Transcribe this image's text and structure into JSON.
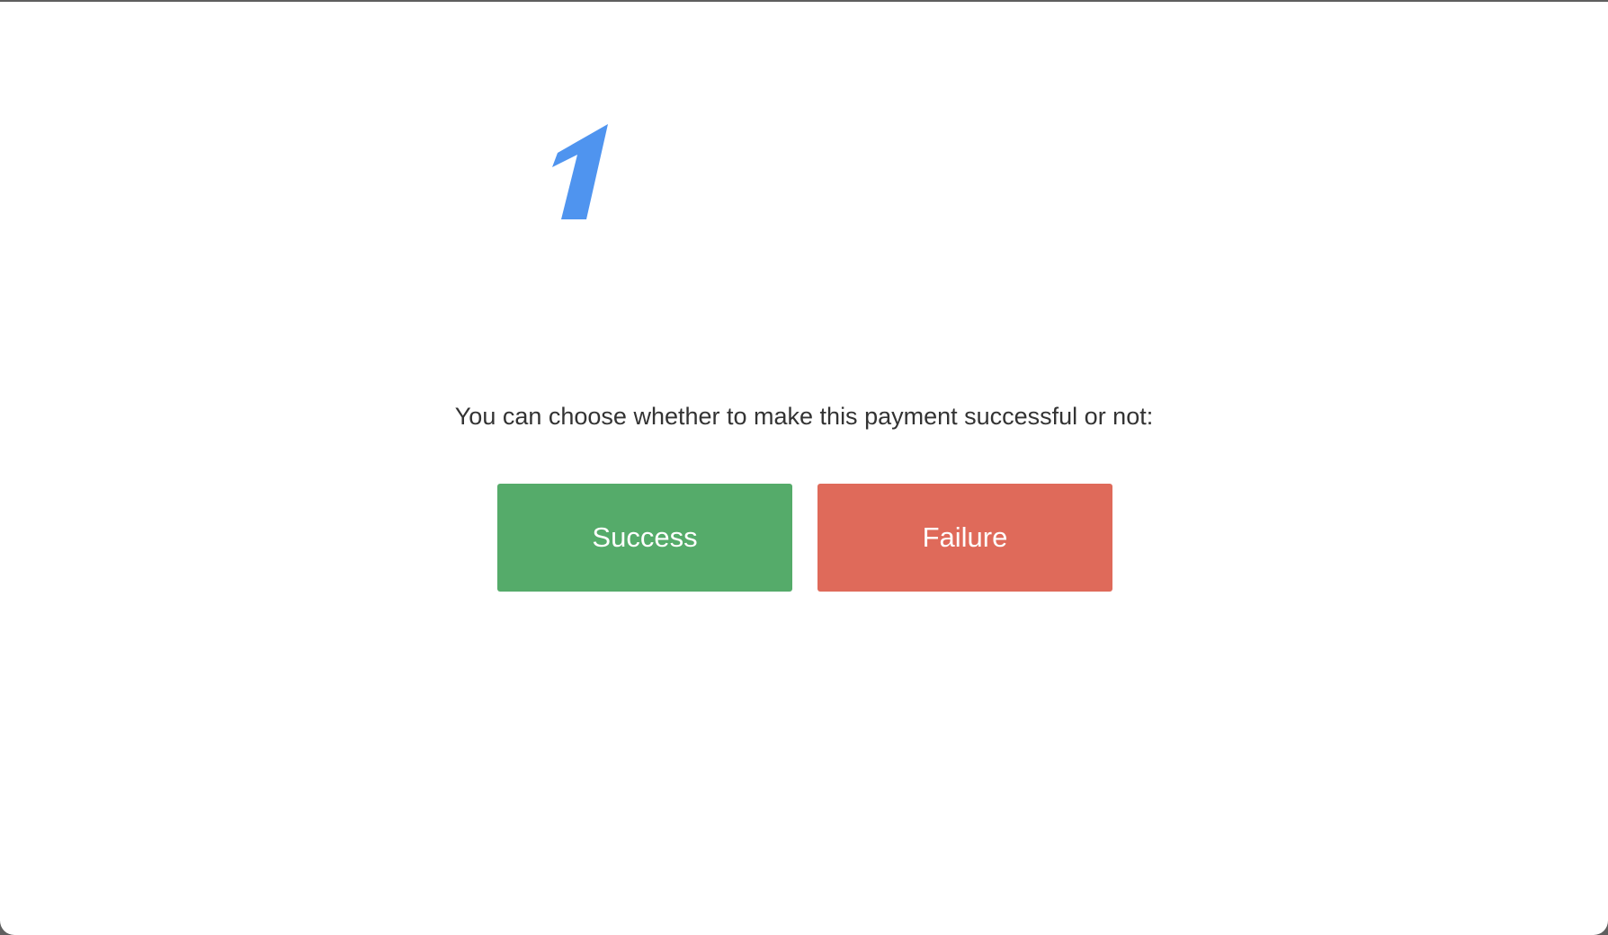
{
  "logo": {
    "icon": "one-logo-icon",
    "color": "#4f94ef"
  },
  "payment": {
    "prompt": "You can choose whether to make this payment successful or not:",
    "success_label": "Success",
    "failure_label": "Failure"
  },
  "colors": {
    "success": "#55ab6a",
    "failure": "#df6a5a",
    "text": "#333333"
  }
}
